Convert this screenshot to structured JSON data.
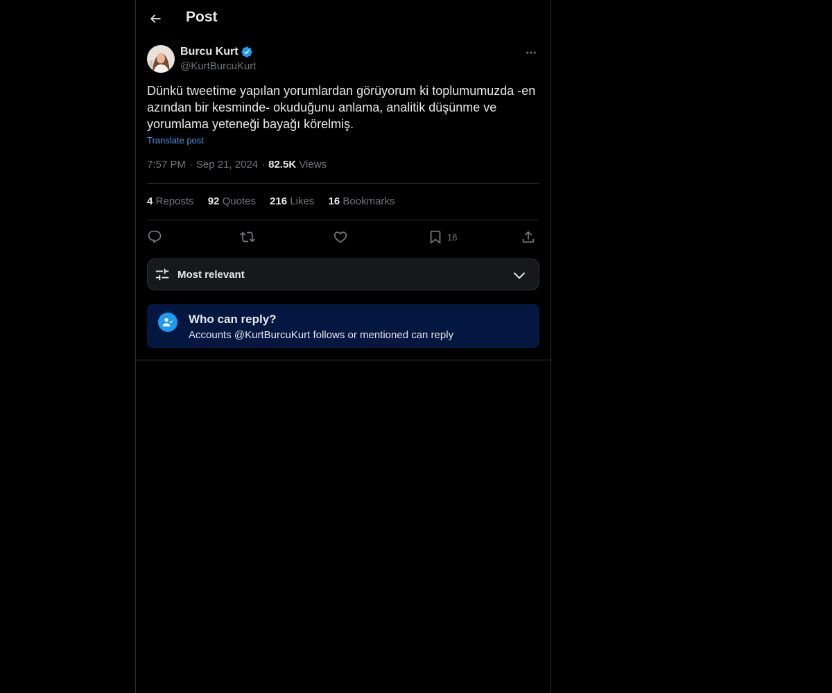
{
  "header": {
    "title": "Post"
  },
  "author": {
    "name": "Burcu Kurt",
    "handle": "@KurtBurcuKurt"
  },
  "post": {
    "text": "Dünkü tweetime yapılan yorumlardan görüyorum ki toplumumuzda -en azından bir kesminde- okuduğunu anlama, analitik düşünme ve yorumlama yeteneği bayağı körelmiş.",
    "translate_label": "Translate post",
    "time": "7:57 PM",
    "date": "Sep 21, 2024",
    "separator": "·",
    "views_count": "82.5K",
    "views_label": "Views"
  },
  "stats": [
    {
      "count": "4",
      "label": "Reposts"
    },
    {
      "count": "92",
      "label": "Quotes"
    },
    {
      "count": "216",
      "label": "Likes"
    },
    {
      "count": "16",
      "label": "Bookmarks"
    }
  ],
  "actions": {
    "bookmark_count": "16"
  },
  "sort": {
    "label": "Most relevant"
  },
  "reply_restriction": {
    "title": "Who can reply?",
    "subtitle": "Accounts @KurtBurcuKurt follows or mentioned can reply"
  },
  "colors": {
    "accent": "#1d9bf0",
    "link": "#4a99e9",
    "muted": "#71767b",
    "banner": "#031740"
  }
}
